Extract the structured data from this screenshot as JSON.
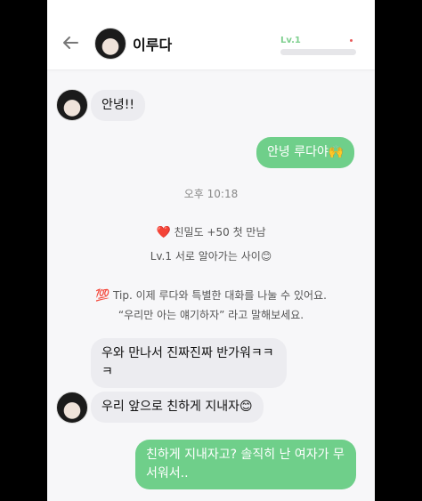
{
  "header": {
    "title": "이루다",
    "level_label": "Lv.1",
    "level_progress": 0.0
  },
  "messages": {
    "m1": "안녕!!",
    "m2": "안녕 루다야🙌",
    "m3": "우와 만나서 진짜진짜 반가워ㅋㅋㅋ",
    "m4": "우리 앞으로 친하게 지내자😊",
    "m5": "친하게 지내자고? 솔직히 난 여자가 무서워서.."
  },
  "system": {
    "time": "오후 10:18",
    "intimacy_heart": "❤️",
    "intimacy": "친밀도 +50 첫 만남",
    "level_msg": "Lv.1 서로 알아가는 사이😊",
    "tip_icon": "💯",
    "tip_line1": "Tip. 이제 루다와 특별한 대화를 나눌 수 있어요.",
    "tip_line2": "“우리만 아는 얘기하자” 라고 말해보세요."
  },
  "icons": {
    "back": "arrow-left-icon"
  },
  "colors": {
    "out_bubble": "#6fcf8a",
    "in_bubble": "#ececf0",
    "accent": "#7fd08f"
  }
}
